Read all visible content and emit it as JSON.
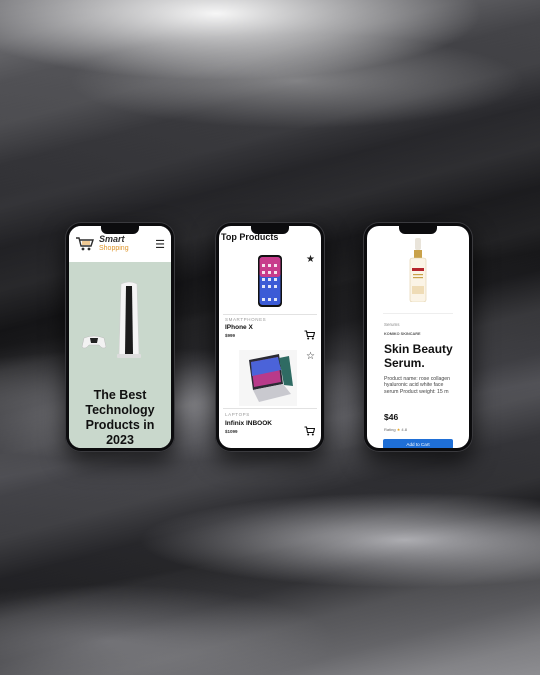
{
  "phone1": {
    "brand_top": "Smart",
    "brand_bottom": "Shopping",
    "menu_icon": "hamburger-menu-icon",
    "hero_heading": "The Best Technology Products in 2023"
  },
  "phone2": {
    "title": "Top Products",
    "products": [
      {
        "category": "SMARTPHONES",
        "name": "IPhone X",
        "price": "$999",
        "favorite": true
      },
      {
        "category": "LAPTOPS",
        "name": "Infinix INBOOK",
        "price": "$1099",
        "favorite": false
      }
    ]
  },
  "phone3": {
    "category": "Serums",
    "subtitle": "KOMIKO SKINCARE",
    "heading": "Skin Beauty Serum.",
    "description": "Product name: rose collagen hyaluronic acid white face serum Product weight: 15 m",
    "price": "$46",
    "rating_label": "Rating",
    "rating_value": "4.8",
    "button_label": "Add to Cart"
  },
  "colors": {
    "hero_bg": "#c9d8cc",
    "brand_accent": "#e0962a",
    "button_blue": "#1f6fd6"
  }
}
